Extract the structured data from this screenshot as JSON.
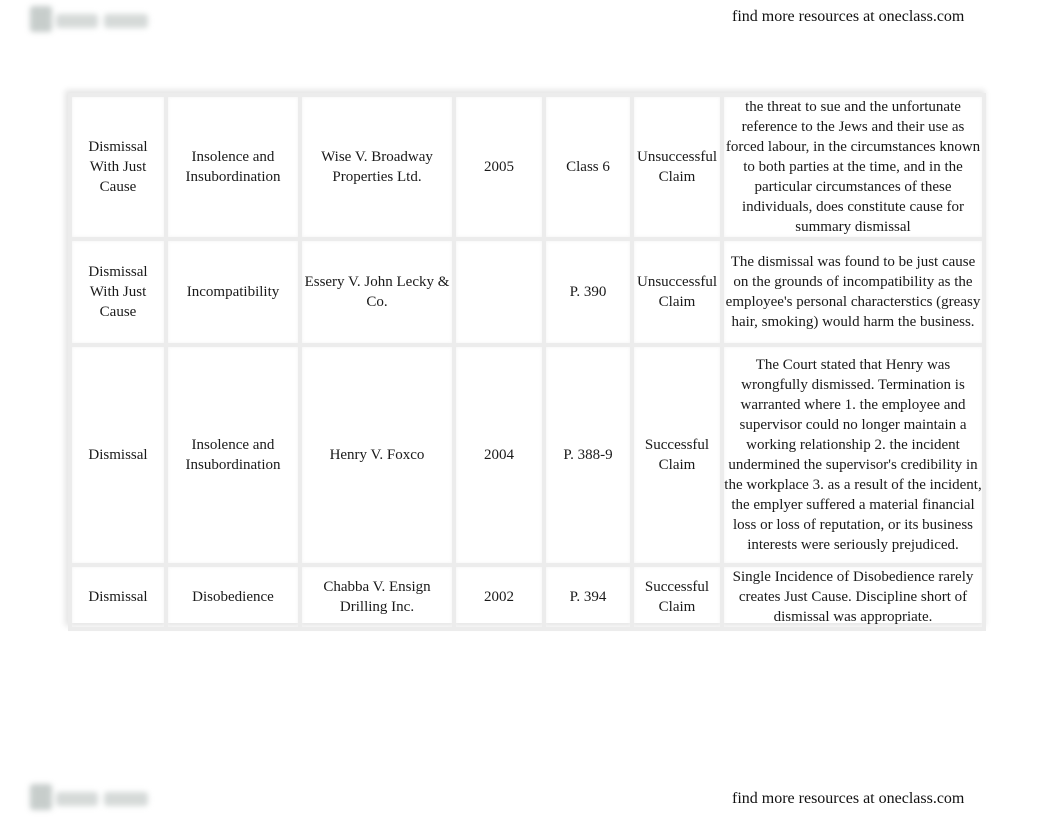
{
  "header": {
    "logo_icon": "oneclass-logo-icon",
    "resources_link": "find more resources at oneclass.com"
  },
  "footer": {
    "logo_icon": "oneclass-logo-icon",
    "resources_link": "find more resources at oneclass.com"
  },
  "table": {
    "rows": [
      {
        "type": "Dismissal With Just Cause",
        "ground": "Insolence and Insubordination",
        "case": "Wise V. Broadway Properties Ltd.",
        "year": "2005",
        "reference": "Class 6",
        "outcome": "Unsuccessful Claim",
        "analysis": "the threat to sue and the unfortunate reference to the Jews and their use as forced labour, in the circumstances known to both parties at the time, and in the particular circumstances of these individuals, does constitute cause for summary dismissal"
      },
      {
        "type": "Dismissal With Just Cause",
        "ground": "Incompatibility",
        "case": "Essery V. John Lecky & Co.",
        "year": "",
        "reference": "P. 390",
        "outcome": "Unsuccessful Claim",
        "analysis": "The dismissal was found to be just cause on the grounds of incompatibility as the employee's personal characterstics (greasy hair, smoking) would harm the business."
      },
      {
        "type": "Dismissal",
        "ground": "Insolence and Insubordination",
        "case": "Henry V. Foxco",
        "year": "2004",
        "reference": "P. 388-9",
        "outcome": "Successful Claim",
        "analysis": "The Court stated that Henry was wrongfully dismissed. Termination is warranted where 1. the employee and supervisor could no longer maintain a working relationship 2. the incident undermined the supervisor's credibility in the workplace 3. as a result of the incident, the emplyer suffered a material financial loss or loss of reputation, or its business interests were seriously prejudiced."
      },
      {
        "type": "Dismissal",
        "ground": "Disobedience",
        "case": "Chabba V. Ensign Drilling Inc.",
        "year": "2002",
        "reference": "P. 394",
        "outcome": "Successful Claim",
        "analysis": "Single Incidence of Disobedience rarely creates Just Cause. Discipline short of dismissal was appropriate."
      }
    ]
  }
}
